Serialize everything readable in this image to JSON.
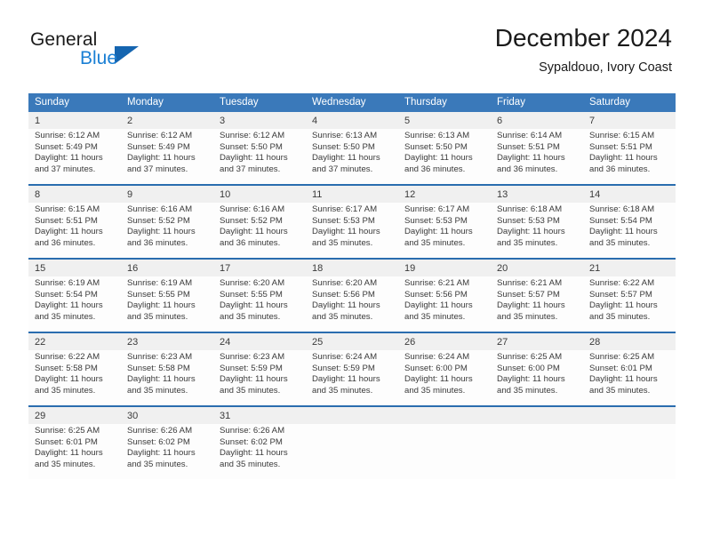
{
  "brand": {
    "name_part1": "General",
    "name_part2": "Blue"
  },
  "header": {
    "month_title": "December 2024",
    "location": "Sypaldouo, Ivory Coast"
  },
  "colors": {
    "header_blue": "#3a79ba",
    "separator_blue": "#2a6daf",
    "daynum_background": "#f0f0f0",
    "logo_blue": "#1a7fd4",
    "logo_triangle": "#1565b0"
  },
  "calendar": {
    "weekday_headers": [
      "Sunday",
      "Monday",
      "Tuesday",
      "Wednesday",
      "Thursday",
      "Friday",
      "Saturday"
    ],
    "weeks": [
      {
        "days": [
          {
            "num": "1",
            "sunrise": "Sunrise: 6:12 AM",
            "sunset": "Sunset: 5:49 PM",
            "daylight1": "Daylight: 11 hours",
            "daylight2": "and 37 minutes."
          },
          {
            "num": "2",
            "sunrise": "Sunrise: 6:12 AM",
            "sunset": "Sunset: 5:49 PM",
            "daylight1": "Daylight: 11 hours",
            "daylight2": "and 37 minutes."
          },
          {
            "num": "3",
            "sunrise": "Sunrise: 6:12 AM",
            "sunset": "Sunset: 5:50 PM",
            "daylight1": "Daylight: 11 hours",
            "daylight2": "and 37 minutes."
          },
          {
            "num": "4",
            "sunrise": "Sunrise: 6:13 AM",
            "sunset": "Sunset: 5:50 PM",
            "daylight1": "Daylight: 11 hours",
            "daylight2": "and 37 minutes."
          },
          {
            "num": "5",
            "sunrise": "Sunrise: 6:13 AM",
            "sunset": "Sunset: 5:50 PM",
            "daylight1": "Daylight: 11 hours",
            "daylight2": "and 36 minutes."
          },
          {
            "num": "6",
            "sunrise": "Sunrise: 6:14 AM",
            "sunset": "Sunset: 5:51 PM",
            "daylight1": "Daylight: 11 hours",
            "daylight2": "and 36 minutes."
          },
          {
            "num": "7",
            "sunrise": "Sunrise: 6:15 AM",
            "sunset": "Sunset: 5:51 PM",
            "daylight1": "Daylight: 11 hours",
            "daylight2": "and 36 minutes."
          }
        ]
      },
      {
        "days": [
          {
            "num": "8",
            "sunrise": "Sunrise: 6:15 AM",
            "sunset": "Sunset: 5:51 PM",
            "daylight1": "Daylight: 11 hours",
            "daylight2": "and 36 minutes."
          },
          {
            "num": "9",
            "sunrise": "Sunrise: 6:16 AM",
            "sunset": "Sunset: 5:52 PM",
            "daylight1": "Daylight: 11 hours",
            "daylight2": "and 36 minutes."
          },
          {
            "num": "10",
            "sunrise": "Sunrise: 6:16 AM",
            "sunset": "Sunset: 5:52 PM",
            "daylight1": "Daylight: 11 hours",
            "daylight2": "and 36 minutes."
          },
          {
            "num": "11",
            "sunrise": "Sunrise: 6:17 AM",
            "sunset": "Sunset: 5:53 PM",
            "daylight1": "Daylight: 11 hours",
            "daylight2": "and 35 minutes."
          },
          {
            "num": "12",
            "sunrise": "Sunrise: 6:17 AM",
            "sunset": "Sunset: 5:53 PM",
            "daylight1": "Daylight: 11 hours",
            "daylight2": "and 35 minutes."
          },
          {
            "num": "13",
            "sunrise": "Sunrise: 6:18 AM",
            "sunset": "Sunset: 5:53 PM",
            "daylight1": "Daylight: 11 hours",
            "daylight2": "and 35 minutes."
          },
          {
            "num": "14",
            "sunrise": "Sunrise: 6:18 AM",
            "sunset": "Sunset: 5:54 PM",
            "daylight1": "Daylight: 11 hours",
            "daylight2": "and 35 minutes."
          }
        ]
      },
      {
        "days": [
          {
            "num": "15",
            "sunrise": "Sunrise: 6:19 AM",
            "sunset": "Sunset: 5:54 PM",
            "daylight1": "Daylight: 11 hours",
            "daylight2": "and 35 minutes."
          },
          {
            "num": "16",
            "sunrise": "Sunrise: 6:19 AM",
            "sunset": "Sunset: 5:55 PM",
            "daylight1": "Daylight: 11 hours",
            "daylight2": "and 35 minutes."
          },
          {
            "num": "17",
            "sunrise": "Sunrise: 6:20 AM",
            "sunset": "Sunset: 5:55 PM",
            "daylight1": "Daylight: 11 hours",
            "daylight2": "and 35 minutes."
          },
          {
            "num": "18",
            "sunrise": "Sunrise: 6:20 AM",
            "sunset": "Sunset: 5:56 PM",
            "daylight1": "Daylight: 11 hours",
            "daylight2": "and 35 minutes."
          },
          {
            "num": "19",
            "sunrise": "Sunrise: 6:21 AM",
            "sunset": "Sunset: 5:56 PM",
            "daylight1": "Daylight: 11 hours",
            "daylight2": "and 35 minutes."
          },
          {
            "num": "20",
            "sunrise": "Sunrise: 6:21 AM",
            "sunset": "Sunset: 5:57 PM",
            "daylight1": "Daylight: 11 hours",
            "daylight2": "and 35 minutes."
          },
          {
            "num": "21",
            "sunrise": "Sunrise: 6:22 AM",
            "sunset": "Sunset: 5:57 PM",
            "daylight1": "Daylight: 11 hours",
            "daylight2": "and 35 minutes."
          }
        ]
      },
      {
        "days": [
          {
            "num": "22",
            "sunrise": "Sunrise: 6:22 AM",
            "sunset": "Sunset: 5:58 PM",
            "daylight1": "Daylight: 11 hours",
            "daylight2": "and 35 minutes."
          },
          {
            "num": "23",
            "sunrise": "Sunrise: 6:23 AM",
            "sunset": "Sunset: 5:58 PM",
            "daylight1": "Daylight: 11 hours",
            "daylight2": "and 35 minutes."
          },
          {
            "num": "24",
            "sunrise": "Sunrise: 6:23 AM",
            "sunset": "Sunset: 5:59 PM",
            "daylight1": "Daylight: 11 hours",
            "daylight2": "and 35 minutes."
          },
          {
            "num": "25",
            "sunrise": "Sunrise: 6:24 AM",
            "sunset": "Sunset: 5:59 PM",
            "daylight1": "Daylight: 11 hours",
            "daylight2": "and 35 minutes."
          },
          {
            "num": "26",
            "sunrise": "Sunrise: 6:24 AM",
            "sunset": "Sunset: 6:00 PM",
            "daylight1": "Daylight: 11 hours",
            "daylight2": "and 35 minutes."
          },
          {
            "num": "27",
            "sunrise": "Sunrise: 6:25 AM",
            "sunset": "Sunset: 6:00 PM",
            "daylight1": "Daylight: 11 hours",
            "daylight2": "and 35 minutes."
          },
          {
            "num": "28",
            "sunrise": "Sunrise: 6:25 AM",
            "sunset": "Sunset: 6:01 PM",
            "daylight1": "Daylight: 11 hours",
            "daylight2": "and 35 minutes."
          }
        ]
      },
      {
        "days": [
          {
            "num": "29",
            "sunrise": "Sunrise: 6:25 AM",
            "sunset": "Sunset: 6:01 PM",
            "daylight1": "Daylight: 11 hours",
            "daylight2": "and 35 minutes."
          },
          {
            "num": "30",
            "sunrise": "Sunrise: 6:26 AM",
            "sunset": "Sunset: 6:02 PM",
            "daylight1": "Daylight: 11 hours",
            "daylight2": "and 35 minutes."
          },
          {
            "num": "31",
            "sunrise": "Sunrise: 6:26 AM",
            "sunset": "Sunset: 6:02 PM",
            "daylight1": "Daylight: 11 hours",
            "daylight2": "and 35 minutes."
          },
          {
            "num": "",
            "sunrise": "",
            "sunset": "",
            "daylight1": "",
            "daylight2": ""
          },
          {
            "num": "",
            "sunrise": "",
            "sunset": "",
            "daylight1": "",
            "daylight2": ""
          },
          {
            "num": "",
            "sunrise": "",
            "sunset": "",
            "daylight1": "",
            "daylight2": ""
          },
          {
            "num": "",
            "sunrise": "",
            "sunset": "",
            "daylight1": "",
            "daylight2": ""
          }
        ]
      }
    ]
  }
}
